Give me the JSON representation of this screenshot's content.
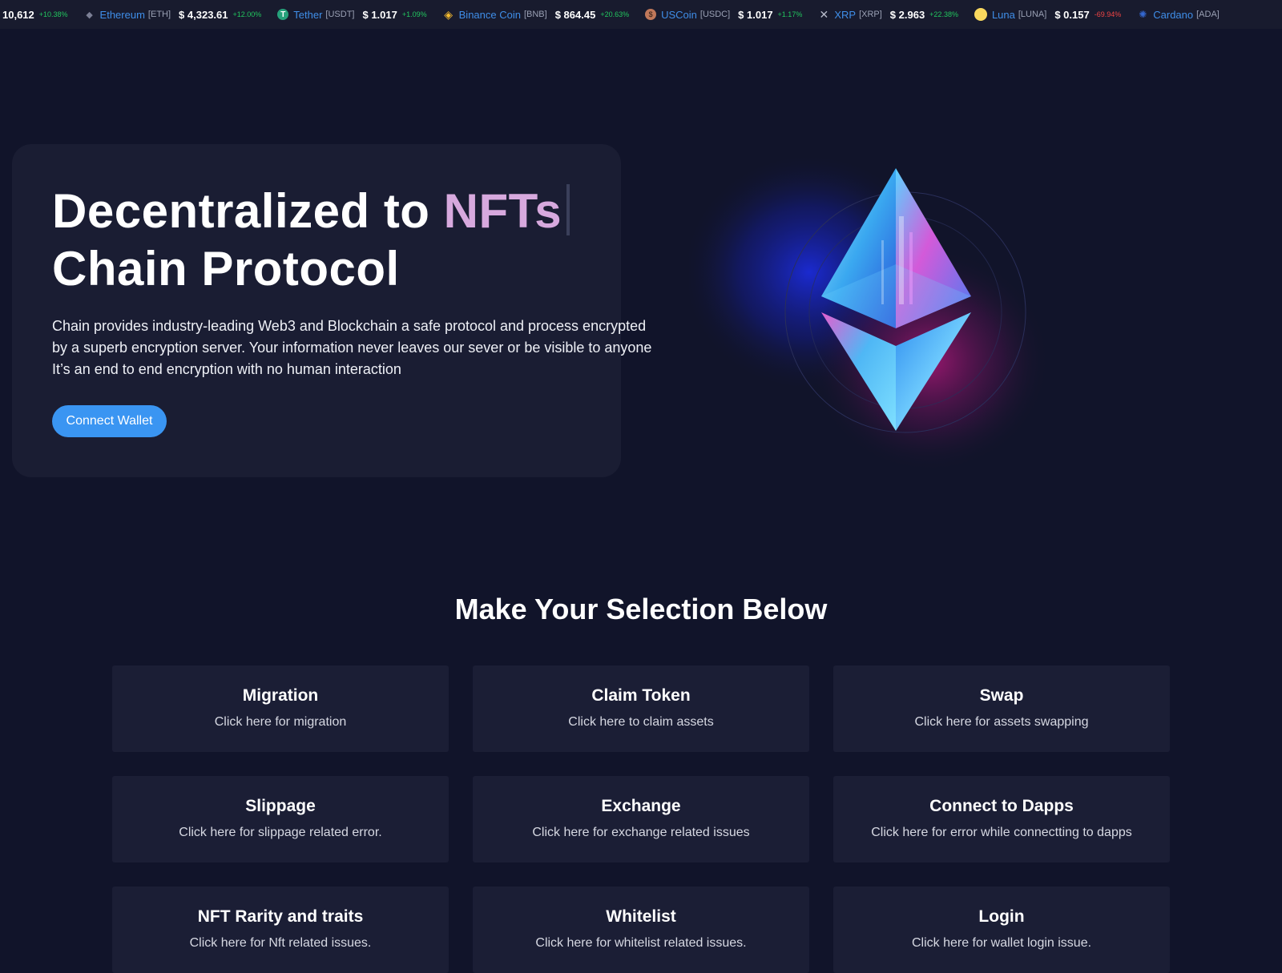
{
  "ticker": {
    "first_price": "10,612",
    "first_change": "+10.38%",
    "items": [
      {
        "name": "Ethereum",
        "symbol": "[ETH]",
        "price": "$ 4,323.61",
        "change": "+12.00%",
        "icon": "ethereum-icon",
        "icon_color": "#7b7f95",
        "trend": "up"
      },
      {
        "name": "Tether",
        "symbol": "[USDT]",
        "price": "$ 1.017",
        "change": "+1.09%",
        "icon": "tether-icon",
        "icon_color": "#26a17b",
        "trend": "up"
      },
      {
        "name": "Binance Coin",
        "symbol": "[BNB]",
        "price": "$ 864.45",
        "change": "+20.63%",
        "icon": "binance-icon",
        "icon_color": "#f3ba2f",
        "trend": "up"
      },
      {
        "name": "USCoin",
        "symbol": "[USDC]",
        "price": "$ 1.017",
        "change": "+1.17%",
        "icon": "usdc-icon",
        "icon_color": "#c0785a",
        "trend": "up"
      },
      {
        "name": "XRP",
        "symbol": "[XRP]",
        "price": "$ 2.963",
        "change": "+22.38%",
        "icon": "xrp-icon",
        "icon_color": "#b8bccb",
        "trend": "up"
      },
      {
        "name": "Luna",
        "symbol": "[LUNA]",
        "price": "$ 0.157",
        "change": "-69.94%",
        "icon": "luna-icon",
        "icon_color": "#f9d85e",
        "trend": "down"
      },
      {
        "name": "Cardano",
        "symbol": "[ADA]",
        "price": "",
        "change": "",
        "icon": "cardano-icon",
        "icon_color": "#3468d1",
        "trend": "up"
      }
    ]
  },
  "hero": {
    "title_prefix": "Decentralized to",
    "title_accent": "NFTs",
    "title_line2": "Chain Protocol",
    "description_line1": "Chain provides industry-leading Web3 and Blockchain a safe protocol and process encrypted",
    "description_line2": "by a superb encryption server. Your information never leaves our sever or be visible to anyone",
    "description_line3": "It’s an end to end encryption with no human interaction",
    "cta_label": "Connect Wallet"
  },
  "section": {
    "title": "Make Your Selection Below",
    "cards": [
      {
        "title": "Migration",
        "subtitle": "Click here for migration"
      },
      {
        "title": "Claim Token",
        "subtitle": "Click here to claim assets"
      },
      {
        "title": "Swap",
        "subtitle": "Click here for assets swapping"
      },
      {
        "title": "Slippage",
        "subtitle": "Click here for slippage related error."
      },
      {
        "title": "Exchange",
        "subtitle": "Click here for exchange related issues"
      },
      {
        "title": "Connect to Dapps",
        "subtitle": "Click here for error while connectting to dapps"
      },
      {
        "title": "NFT Rarity and traits",
        "subtitle": "Click here for Nft related issues."
      },
      {
        "title": "Whitelist",
        "subtitle": "Click here for whitelist related issues."
      },
      {
        "title": "Login",
        "subtitle": "Click here for wallet login issue."
      }
    ]
  },
  "colors": {
    "background": "#11142a",
    "accent": "#d7a9de",
    "button": "#3a95f2",
    "positive": "#22c55e",
    "negative": "#ef4444"
  }
}
